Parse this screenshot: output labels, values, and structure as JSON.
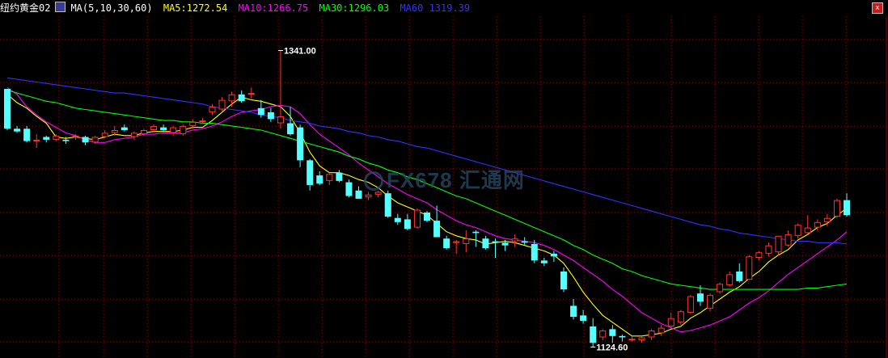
{
  "header": {
    "instrument": "纽约黄金02",
    "indicator": "MA(5,10,30,60)",
    "ma5_label": "MA5:1272.54",
    "ma10_label": "MA10:1266.75",
    "ma30_label": "MA30:1296.03",
    "ma60_label": "MA60 1319.39"
  },
  "colors": {
    "up": "#ff3232",
    "down": "#54ffff",
    "ma5": "#ffff00",
    "ma10": "#ff00ff",
    "ma30": "#00ff00",
    "ma60": "#3232ff",
    "grid": "#8b0000"
  },
  "watermark": "FX678 汇通网",
  "icons": {
    "indicator_icon": "ma-icon",
    "close": "close-icon"
  },
  "chart_data": {
    "type": "candlestick",
    "ylim": [
      1117,
      1366
    ],
    "grid": true,
    "max_label": "1341.00",
    "min_label": "1124.60",
    "ohlc": [
      [
        1313,
        1313,
        1283,
        1284
      ],
      [
        1284,
        1286,
        1281,
        1282
      ],
      [
        1284,
        1286,
        1274,
        1275
      ],
      [
        1275,
        1280,
        1270,
        1276
      ],
      [
        1278,
        1279,
        1274,
        1276
      ],
      [
        1276,
        1280,
        1275,
        1279
      ],
      [
        1276,
        1278,
        1273,
        1275
      ],
      [
        1278,
        1280,
        1276,
        1279
      ],
      [
        1278,
        1279,
        1272,
        1274
      ],
      [
        1274,
        1279,
        1273,
        1278
      ],
      [
        1278,
        1283,
        1277,
        1281
      ],
      [
        1281,
        1286,
        1279,
        1283
      ],
      [
        1285,
        1287,
        1282,
        1283
      ],
      [
        1278,
        1282,
        1276,
        1281
      ],
      [
        1280,
        1284,
        1279,
        1283
      ],
      [
        1283,
        1287,
        1281,
        1286
      ],
      [
        1285,
        1287,
        1282,
        1283
      ],
      [
        1281,
        1286,
        1279,
        1285
      ],
      [
        1280,
        1287,
        1279,
        1286
      ],
      [
        1286,
        1291,
        1284,
        1289
      ],
      [
        1290,
        1292,
        1288,
        1290
      ],
      [
        1296,
        1302,
        1294,
        1300
      ],
      [
        1298,
        1307,
        1297,
        1305
      ],
      [
        1304,
        1311,
        1300,
        1309
      ],
      [
        1309,
        1312,
        1303,
        1304
      ],
      [
        1309,
        1314,
        1306,
        1310
      ],
      [
        1299,
        1305,
        1292,
        1294
      ],
      [
        1296,
        1299,
        1289,
        1291
      ],
      [
        1288,
        1341,
        1284,
        1293
      ],
      [
        1288,
        1300,
        1279,
        1280
      ],
      [
        1285,
        1287,
        1256,
        1261
      ],
      [
        1261,
        1262,
        1239,
        1243
      ],
      [
        1250,
        1253,
        1243,
        1244
      ],
      [
        1246,
        1252,
        1243,
        1251
      ],
      [
        1252,
        1254,
        1245,
        1246
      ],
      [
        1245,
        1247,
        1234,
        1235
      ],
      [
        1239,
        1242,
        1233,
        1233
      ],
      [
        1234,
        1238,
        1232,
        1236
      ],
      [
        1236,
        1239,
        1234,
        1238
      ],
      [
        1237,
        1239,
        1219,
        1220
      ],
      [
        1219,
        1222,
        1214,
        1216
      ],
      [
        1218,
        1222,
        1210,
        1211
      ],
      [
        1212,
        1226,
        1211,
        1225
      ],
      [
        1223,
        1224,
        1216,
        1217
      ],
      [
        1217,
        1228,
        1205,
        1205
      ],
      [
        1204,
        1206,
        1196,
        1197
      ],
      [
        1201,
        1203,
        1193,
        1202
      ],
      [
        1200,
        1210,
        1194,
        1204
      ],
      [
        1209,
        1210,
        1198,
        1208
      ],
      [
        1204,
        1206,
        1196,
        1197
      ],
      [
        1202,
        1204,
        1190,
        1201
      ],
      [
        1201,
        1203,
        1195,
        1199
      ],
      [
        1202,
        1207,
        1198,
        1204
      ],
      [
        1202,
        1205,
        1199,
        1201
      ],
      [
        1200,
        1203,
        1186,
        1188
      ],
      [
        1188,
        1190,
        1184,
        1186
      ],
      [
        1193,
        1195,
        1187,
        1191
      ],
      [
        1180,
        1183,
        1165,
        1167
      ],
      [
        1155,
        1160,
        1145,
        1147
      ],
      [
        1148,
        1152,
        1142,
        1144
      ],
      [
        1140,
        1146,
        1125,
        1128
      ],
      [
        1132,
        1138,
        1130,
        1137
      ],
      [
        1138,
        1141,
        1128,
        1133
      ],
      [
        1133,
        1134,
        1129,
        1132
      ],
      [
        1131,
        1133,
        1129,
        1131
      ],
      [
        1130,
        1133,
        1128,
        1132
      ],
      [
        1132,
        1138,
        1130,
        1137
      ],
      [
        1135,
        1141,
        1133,
        1139
      ],
      [
        1140,
        1150,
        1139,
        1146
      ],
      [
        1143,
        1152,
        1141,
        1151
      ],
      [
        1150,
        1163,
        1149,
        1162
      ],
      [
        1164,
        1170,
        1155,
        1158
      ],
      [
        1153,
        1164,
        1151,
        1163
      ],
      [
        1165,
        1172,
        1164,
        1171
      ],
      [
        1170,
        1180,
        1169,
        1178
      ],
      [
        1180,
        1186,
        1172,
        1173
      ],
      [
        1174,
        1192,
        1174,
        1191
      ],
      [
        1190,
        1195,
        1188,
        1194
      ],
      [
        1193,
        1201,
        1191,
        1199
      ],
      [
        1194,
        1206,
        1192,
        1206
      ],
      [
        1199,
        1210,
        1198,
        1207
      ],
      [
        1206,
        1215,
        1204,
        1214
      ],
      [
        1208,
        1221,
        1207,
        1212
      ],
      [
        1212,
        1218,
        1210,
        1216
      ],
      [
        1216,
        1222,
        1213,
        1219
      ],
      [
        1220,
        1233,
        1219,
        1232
      ],
      [
        1232,
        1237,
        1220,
        1221
      ]
    ],
    "series": [
      {
        "name": "MA5",
        "values": [
          1309,
          1303,
          1299,
          1293,
          1288,
          1278,
          1277,
          1278,
          1277,
          1276,
          1278,
          1280,
          1279,
          1279,
          1281,
          1282,
          1282,
          1282,
          1283,
          1285,
          1285,
          1290,
          1296,
          1302,
          1307,
          1305,
          1304,
          1302,
          1300,
          1293,
          1281,
          1267,
          1257,
          1252,
          1252,
          1250,
          1247,
          1245,
          1241,
          1235,
          1230,
          1227,
          1224,
          1221,
          1215,
          1209,
          1206,
          1204,
          1203,
          1200,
          1201,
          1202,
          1201,
          1199,
          1197,
          1195,
          1192,
          1186,
          1176,
          1165,
          1156,
          1148,
          1143,
          1138,
          1133,
          1133,
          1134,
          1135,
          1138,
          1140,
          1146,
          1150,
          1155,
          1160,
          1165,
          1169,
          1175,
          1180,
          1187,
          1192,
          1196,
          1203,
          1207,
          1212,
          1215,
          1221,
          1226
        ]
      },
      {
        "name": "MA10",
        "values": [
          1314,
          1309,
          1300,
          1294,
          1289,
          1285,
          1281,
          1279,
          1276,
          1274,
          1274,
          1276,
          1277,
          1278,
          1280,
          1280,
          1281,
          1281,
          1281,
          1283,
          1284,
          1286,
          1289,
          1293,
          1296,
          1297,
          1298,
          1300,
          1301,
          1300,
          1295,
          1287,
          1280,
          1275,
          1270,
          1265,
          1259,
          1254,
          1249,
          1244,
          1240,
          1236,
          1233,
          1230,
          1225,
          1221,
          1217,
          1214,
          1212,
          1209,
          1206,
          1204,
          1203,
          1202,
          1201,
          1199,
          1196,
          1192,
          1188,
          1183,
          1178,
          1173,
          1167,
          1162,
          1156,
          1150,
          1146,
          1142,
          1139,
          1136,
          1137,
          1139,
          1141,
          1144,
          1147,
          1152,
          1157,
          1161,
          1166,
          1172,
          1178,
          1183,
          1188,
          1193,
          1198,
          1203,
          1209
        ]
      },
      {
        "name": "MA30",
        "values": [
          1312,
          1310,
          1308,
          1306,
          1304,
          1303,
          1301,
          1299,
          1298,
          1297,
          1296,
          1295,
          1294,
          1293,
          1292,
          1291,
          1290,
          1290,
          1289,
          1289,
          1288,
          1288,
          1287,
          1286,
          1285,
          1284,
          1283,
          1281,
          1279,
          1277,
          1275,
          1273,
          1271,
          1269,
          1267,
          1264,
          1262,
          1259,
          1257,
          1254,
          1252,
          1249,
          1247,
          1244,
          1241,
          1238,
          1235,
          1233,
          1230,
          1227,
          1224,
          1221,
          1218,
          1215,
          1212,
          1209,
          1206,
          1203,
          1199,
          1196,
          1192,
          1189,
          1186,
          1182,
          1180,
          1177,
          1175,
          1173,
          1171,
          1170,
          1169,
          1168,
          1167,
          1167,
          1167,
          1167,
          1167,
          1167,
          1167,
          1167,
          1167,
          1167,
          1168,
          1168,
          1169,
          1170,
          1171
        ]
      },
      {
        "name": "MA60",
        "values": [
          1321,
          1320,
          1319,
          1318,
          1317,
          1316,
          1315,
          1314,
          1313,
          1312,
          1311,
          1310,
          1310,
          1309,
          1308,
          1307,
          1306,
          1305,
          1304,
          1303,
          1302,
          1300,
          1299,
          1298,
          1297,
          1296,
          1294,
          1293,
          1292,
          1290,
          1289,
          1288,
          1286,
          1285,
          1284,
          1282,
          1281,
          1279,
          1278,
          1276,
          1275,
          1273,
          1271,
          1270,
          1268,
          1266,
          1264,
          1262,
          1260,
          1258,
          1256,
          1254,
          1252,
          1250,
          1248,
          1246,
          1244,
          1242,
          1240,
          1238,
          1236,
          1234,
          1232,
          1230,
          1228,
          1226,
          1224,
          1222,
          1220,
          1218,
          1216,
          1214,
          1213,
          1211,
          1210,
          1208,
          1207,
          1206,
          1205,
          1204,
          1203,
          1202,
          1202,
          1201,
          1201,
          1201,
          1200
        ]
      }
    ]
  }
}
